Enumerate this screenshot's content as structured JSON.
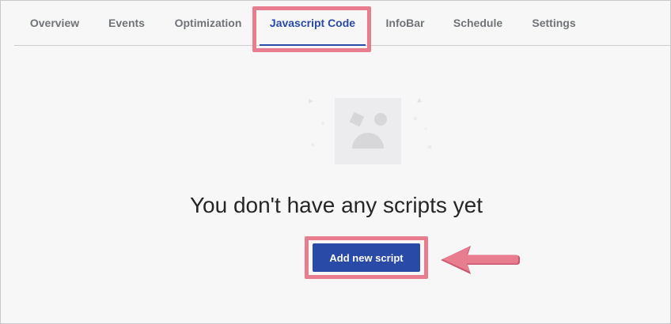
{
  "tabs": [
    {
      "label": "Overview"
    },
    {
      "label": "Events"
    },
    {
      "label": "Optimization"
    },
    {
      "label": "Javascript Code"
    },
    {
      "label": "InfoBar"
    },
    {
      "label": "Schedule"
    },
    {
      "label": "Settings"
    }
  ],
  "active_tab": "Javascript Code",
  "empty_state": {
    "title": "You don't have any scripts yet",
    "button_label": "Add new script",
    "illustration_icon": "sad-face-placeholder-icon"
  },
  "colors": {
    "accent": "#2a4aa8",
    "highlight": "#e87d90",
    "tab_text": "#707378",
    "background": "#f7f7f8"
  }
}
